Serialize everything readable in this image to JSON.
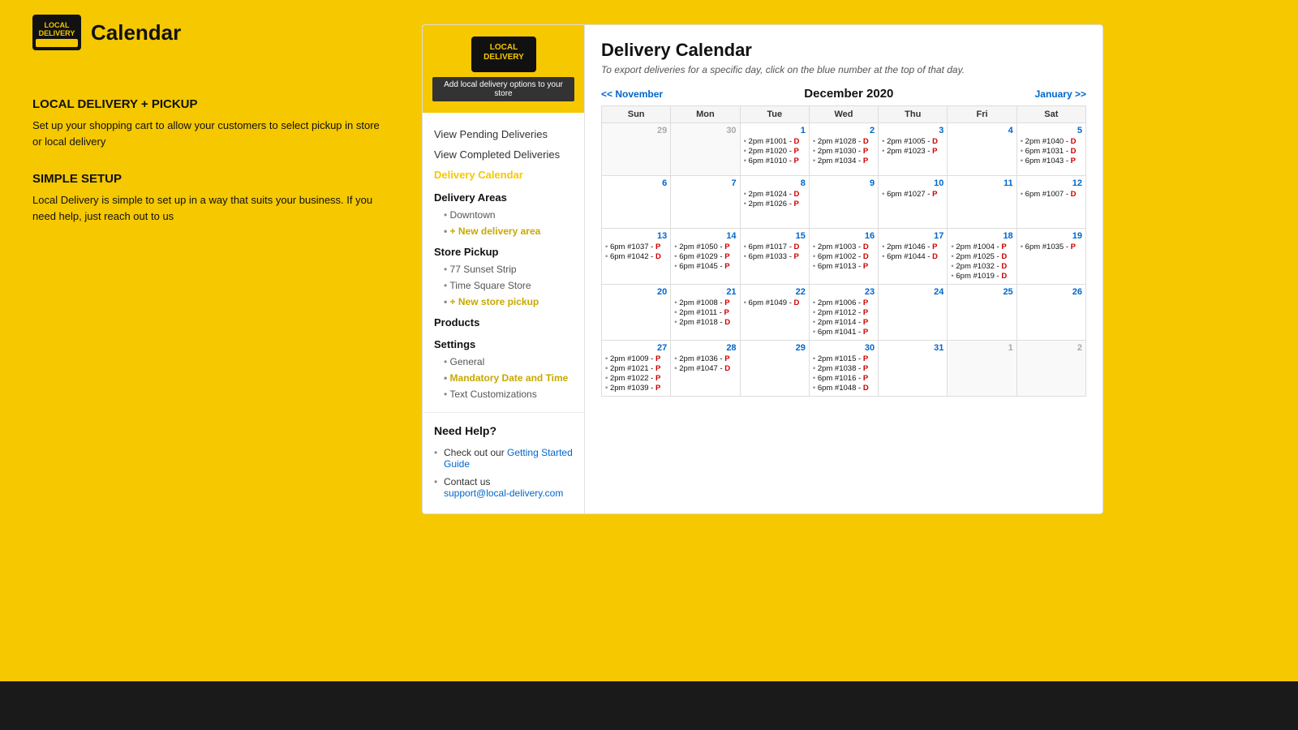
{
  "header": {
    "title": "Calendar",
    "logo_text": "LOCAL\nDELIVERY"
  },
  "left_sidebar": {
    "section1": {
      "heading": "LOCAL DELIVERY + PICKUP",
      "text": "Set up your shopping cart to allow your customers to select pickup in store or local delivery"
    },
    "section2": {
      "heading": "SIMPLE SETUP",
      "text": "Local Delivery is simple to set up in a way that suits your business. If you need help, just reach out to us"
    }
  },
  "card_sidebar": {
    "add_btn": "Add local delivery options to your store",
    "nav_items": [
      {
        "label": "View Pending Deliveries",
        "active": false
      },
      {
        "label": "View Completed Deliveries",
        "active": false
      },
      {
        "label": "Delivery Calendar",
        "active": true
      }
    ],
    "delivery_areas_title": "Delivery Areas",
    "delivery_areas": [
      {
        "label": "Downtown"
      },
      {
        "label": "+ New delivery area",
        "special": true
      }
    ],
    "store_pickup_title": "Store Pickup",
    "store_pickups": [
      {
        "label": "77 Sunset Strip"
      },
      {
        "label": "Time Square Store"
      },
      {
        "label": "+ New store pickup",
        "special": true
      }
    ],
    "products_title": "Products",
    "settings_title": "Settings",
    "settings_items": [
      {
        "label": "General"
      },
      {
        "label": "Mandatory Date and Time",
        "special": true
      },
      {
        "label": "Text Customizations"
      }
    ],
    "need_help": {
      "title": "Need Help?",
      "items": [
        {
          "text": "Check out our ",
          "link_text": "Getting Started Guide",
          "link": "#"
        },
        {
          "text": "Contact us"
        },
        {
          "email": "support@local-delivery.com"
        }
      ]
    }
  },
  "calendar": {
    "title": "Delivery Calendar",
    "subtitle": "To export deliveries for a specific day, click on the blue number at the top of that day.",
    "prev_label": "<< November",
    "next_label": "January >>",
    "month_title": "December 2020",
    "days_of_week": [
      "Sun",
      "Mon",
      "Tue",
      "Wed",
      "Thu",
      "Fri",
      "Sat"
    ],
    "weeks": [
      {
        "days": [
          {
            "num": "29",
            "other": true,
            "deliveries": []
          },
          {
            "num": "30",
            "other": true,
            "deliveries": []
          },
          {
            "num": "1",
            "other": false,
            "deliveries": [
              {
                "time": "2pm",
                "order": "#1001",
                "status": "D"
              },
              {
                "time": "2pm",
                "order": "#1020",
                "status": "P"
              },
              {
                "time": "6pm",
                "order": "#1010",
                "status": "P"
              }
            ]
          },
          {
            "num": "2",
            "other": false,
            "deliveries": [
              {
                "time": "2pm",
                "order": "#1028",
                "status": "D"
              },
              {
                "time": "2pm",
                "order": "#1030",
                "status": "P"
              },
              {
                "time": "2pm",
                "order": "#1034",
                "status": "P"
              }
            ]
          },
          {
            "num": "3",
            "other": false,
            "deliveries": [
              {
                "time": "2pm",
                "order": "#1005",
                "status": "D"
              },
              {
                "time": "2pm",
                "order": "#1023",
                "status": "P"
              }
            ]
          },
          {
            "num": "4",
            "other": false,
            "deliveries": []
          },
          {
            "num": "5",
            "other": false,
            "deliveries": [
              {
                "time": "2pm",
                "order": "#1040",
                "status": "D"
              },
              {
                "time": "6pm",
                "order": "#1031",
                "status": "D"
              },
              {
                "time": "6pm",
                "order": "#1043",
                "status": "P"
              }
            ]
          }
        ]
      },
      {
        "days": [
          {
            "num": "6",
            "other": false,
            "deliveries": []
          },
          {
            "num": "7",
            "other": false,
            "deliveries": []
          },
          {
            "num": "8",
            "other": false,
            "deliveries": [
              {
                "time": "2pm",
                "order": "#1024",
                "status": "D"
              },
              {
                "time": "2pm",
                "order": "#1026",
                "status": "P"
              }
            ]
          },
          {
            "num": "9",
            "other": false,
            "deliveries": []
          },
          {
            "num": "10",
            "other": false,
            "deliveries": [
              {
                "time": "6pm",
                "order": "#1027",
                "status": "P"
              }
            ]
          },
          {
            "num": "11",
            "other": false,
            "deliveries": []
          },
          {
            "num": "12",
            "other": false,
            "deliveries": [
              {
                "time": "6pm",
                "order": "#1007",
                "status": "D"
              }
            ]
          }
        ]
      },
      {
        "days": [
          {
            "num": "13",
            "other": false,
            "deliveries": [
              {
                "time": "6pm",
                "order": "#1037",
                "status": "P"
              },
              {
                "time": "6pm",
                "order": "#1042",
                "status": "D"
              }
            ]
          },
          {
            "num": "14",
            "other": false,
            "deliveries": [
              {
                "time": "2pm",
                "order": "#1050",
                "status": "P"
              },
              {
                "time": "6pm",
                "order": "#1029",
                "status": "P"
              },
              {
                "time": "6pm",
                "order": "#1045",
                "status": "P"
              }
            ]
          },
          {
            "num": "15",
            "other": false,
            "deliveries": [
              {
                "time": "6pm",
                "order": "#1017",
                "status": "D"
              },
              {
                "time": "6pm",
                "order": "#1033",
                "status": "P"
              }
            ]
          },
          {
            "num": "16",
            "other": false,
            "deliveries": [
              {
                "time": "2pm",
                "order": "#1003",
                "status": "D"
              },
              {
                "time": "6pm",
                "order": "#1002",
                "status": "D"
              },
              {
                "time": "6pm",
                "order": "#1013",
                "status": "P"
              }
            ]
          },
          {
            "num": "17",
            "other": false,
            "deliveries": [
              {
                "time": "2pm",
                "order": "#1046",
                "status": "P"
              },
              {
                "time": "6pm",
                "order": "#1044",
                "status": "D"
              }
            ]
          },
          {
            "num": "18",
            "other": false,
            "deliveries": [
              {
                "time": "2pm",
                "order": "#1004",
                "status": "P"
              },
              {
                "time": "2pm",
                "order": "#1025",
                "status": "D"
              },
              {
                "time": "2pm",
                "order": "#1032",
                "status": "D"
              },
              {
                "time": "6pm",
                "order": "#1019",
                "status": "D"
              }
            ]
          },
          {
            "num": "19",
            "other": false,
            "deliveries": [
              {
                "time": "6pm",
                "order": "#1035",
                "status": "P"
              }
            ]
          }
        ]
      },
      {
        "days": [
          {
            "num": "20",
            "other": false,
            "deliveries": []
          },
          {
            "num": "21",
            "other": false,
            "deliveries": [
              {
                "time": "2pm",
                "order": "#1008",
                "status": "P"
              },
              {
                "time": "2pm",
                "order": "#1011",
                "status": "P"
              },
              {
                "time": "2pm",
                "order": "#1018",
                "status": "D"
              }
            ]
          },
          {
            "num": "22",
            "other": false,
            "deliveries": [
              {
                "time": "6pm",
                "order": "#1049",
                "status": "D"
              }
            ]
          },
          {
            "num": "23",
            "other": false,
            "deliveries": [
              {
                "time": "2pm",
                "order": "#1006",
                "status": "P"
              },
              {
                "time": "2pm",
                "order": "#1012",
                "status": "P"
              },
              {
                "time": "2pm",
                "order": "#1014",
                "status": "P"
              },
              {
                "time": "6pm",
                "order": "#1041",
                "status": "P"
              }
            ]
          },
          {
            "num": "24",
            "other": false,
            "deliveries": []
          },
          {
            "num": "25",
            "other": false,
            "deliveries": []
          },
          {
            "num": "26",
            "other": false,
            "deliveries": []
          }
        ]
      },
      {
        "days": [
          {
            "num": "27",
            "other": false,
            "deliveries": [
              {
                "time": "2pm",
                "order": "#1009",
                "status": "P"
              },
              {
                "time": "2pm",
                "order": "#1021",
                "status": "P"
              },
              {
                "time": "2pm",
                "order": "#1022",
                "status": "P"
              },
              {
                "time": "2pm",
                "order": "#1039",
                "status": "P"
              }
            ]
          },
          {
            "num": "28",
            "other": false,
            "deliveries": [
              {
                "time": "2pm",
                "order": "#1036",
                "status": "P"
              },
              {
                "time": "2pm",
                "order": "#1047",
                "status": "D"
              }
            ]
          },
          {
            "num": "29",
            "other": false,
            "deliveries": []
          },
          {
            "num": "30",
            "other": false,
            "deliveries": [
              {
                "time": "2pm",
                "order": "#1015",
                "status": "P"
              },
              {
                "time": "2pm",
                "order": "#1038",
                "status": "P"
              },
              {
                "time": "6pm",
                "order": "#1016",
                "status": "P"
              },
              {
                "time": "6pm",
                "order": "#1048",
                "status": "D"
              }
            ]
          },
          {
            "num": "31",
            "other": false,
            "deliveries": []
          },
          {
            "num": "1",
            "other": true,
            "deliveries": []
          },
          {
            "num": "2",
            "other": true,
            "deliveries": []
          }
        ]
      }
    ]
  }
}
